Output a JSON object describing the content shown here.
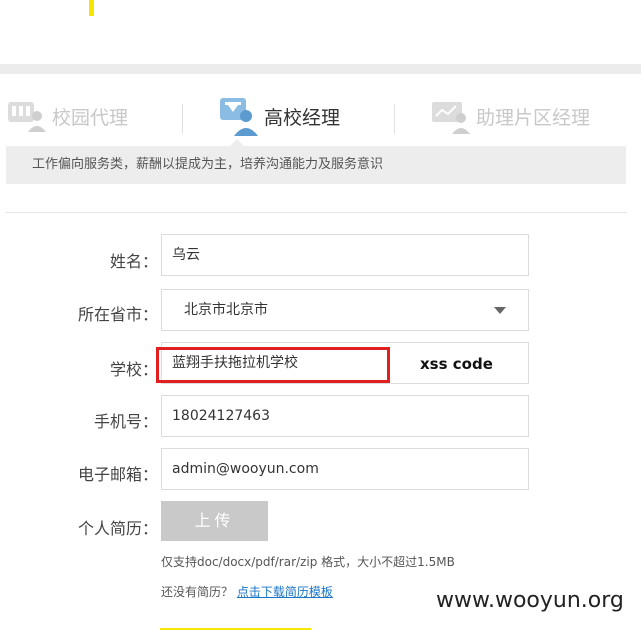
{
  "tabs": [
    {
      "label": "校园代理",
      "active": false,
      "icon": "school-agent-icon"
    },
    {
      "label": "高校经理",
      "active": true,
      "icon": "manager-icon"
    },
    {
      "label": "助理片区经理",
      "active": false,
      "icon": "area-manager-icon"
    }
  ],
  "notice": "工作偏向服务类，薪酬以提成为主，培养沟通能力及服务意识",
  "form": {
    "name_label": "姓名：",
    "name_value": "乌云",
    "province_label": "所在省市：",
    "province_value": "北京市北京市",
    "school_label": "学校：",
    "school_value": "蓝翔手扶拖拉机学校",
    "school_annotation": "xss code",
    "phone_label": "手机号：",
    "phone_value": "18024127463",
    "email_label": "电子邮箱：",
    "email_value": "admin@wooyun.com",
    "resume_label": "个人简历：",
    "upload_label": "上传",
    "upload_hint": "仅支持doc/docx/pdf/rar/zip 格式，大小不超过1.5MB",
    "no_resume_text": "还没有简历？",
    "download_link": "点击下载简历模板"
  },
  "watermark": "www.wooyun.org",
  "colors": {
    "accent_blue": "#7fb3dc",
    "highlight_red": "#e02020",
    "link_blue": "#1a75c8"
  }
}
